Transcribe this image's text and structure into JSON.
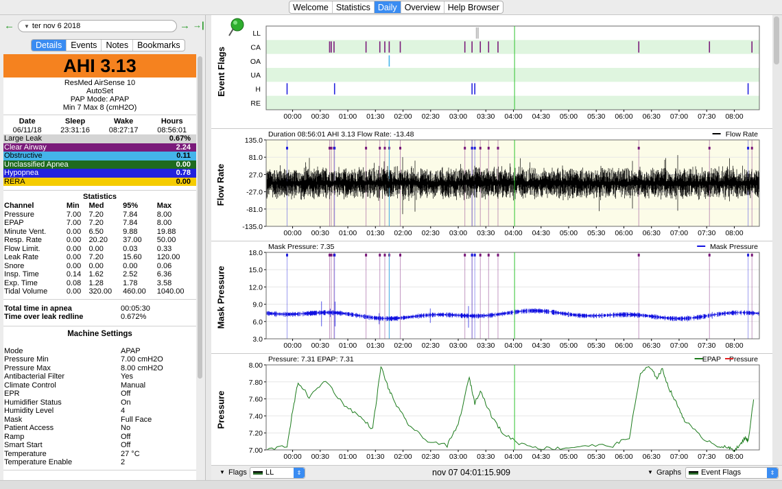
{
  "top_tabs": [
    {
      "label": "Welcome"
    },
    {
      "label": "Statistics"
    },
    {
      "label": "Daily",
      "active": true
    },
    {
      "label": "Overview"
    },
    {
      "label": "Help Browser"
    }
  ],
  "nav": {
    "date": "ter nov 6 2018",
    "back_icon": "arrow-left-icon",
    "forward_icon": "arrow-right-icon",
    "last_icon": "jump-to-last-icon"
  },
  "left_tabs": [
    {
      "label": "Details",
      "active": true
    },
    {
      "label": "Events"
    },
    {
      "label": "Notes"
    },
    {
      "label": "Bookmarks"
    }
  ],
  "summary": {
    "ahi": "AHI 3.13",
    "machine": "ResMed AirSense 10",
    "model": "AutoSet",
    "mode": "PAP Mode: APAP",
    "range": "Min 7 Max 8 (cmH2O)"
  },
  "session": {
    "headers": [
      "Date",
      "Sleep",
      "Wake",
      "Hours"
    ],
    "values": [
      "06/11/18",
      "23:31:16",
      "08:27:17",
      "08:56:01"
    ]
  },
  "events": [
    {
      "name": "Large Leak",
      "value": "0.67%",
      "color": "#d4d4d4",
      "text": "#000"
    },
    {
      "name": "Clear Airway",
      "value": "2.24",
      "color": "#7a1a7a",
      "text": "#fff"
    },
    {
      "name": "Obstructive",
      "value": "0.11",
      "color": "#44b4ea",
      "text": "#000"
    },
    {
      "name": "Unclassified Apnea",
      "value": "0.00",
      "color": "#1e6a1e",
      "text": "#fff"
    },
    {
      "name": "Hypopnea",
      "value": "0.78",
      "color": "#2222dd",
      "text": "#fff"
    },
    {
      "name": "RERA",
      "value": "0.00",
      "color": "#f5cc00",
      "text": "#000"
    }
  ],
  "statistics": {
    "title": "Statistics",
    "headers": [
      "Channel",
      "Min",
      "Med",
      "95%",
      "Max"
    ],
    "rows": [
      [
        "Pressure",
        "7.00",
        "7.20",
        "7.84",
        "8.00"
      ],
      [
        "EPAP",
        "7.00",
        "7.20",
        "7.84",
        "8.00"
      ],
      [
        "Minute Vent.",
        "0.00",
        "6.50",
        "9.88",
        "19.88"
      ],
      [
        "Resp. Rate",
        "0.00",
        "20.20",
        "37.00",
        "50.00"
      ],
      [
        "Flow Limit.",
        "0.00",
        "0.00",
        "0.03",
        "0.33"
      ],
      [
        "Leak Rate",
        "0.00",
        "7.20",
        "15.60",
        "120.00"
      ],
      [
        "Snore",
        "0.00",
        "0.00",
        "0.00",
        "0.06"
      ],
      [
        "Insp. Time",
        "0.14",
        "1.62",
        "2.52",
        "6.36"
      ],
      [
        "Exp. Time",
        "0.08",
        "1.28",
        "1.78",
        "3.58"
      ],
      [
        "Tidal Volume",
        "0.00",
        "320.00",
        "460.00",
        "1040.00"
      ]
    ]
  },
  "apnea": [
    {
      "label": "Total time in apnea",
      "value": "00:05:30"
    },
    {
      "label": "Time over leak redline",
      "value": "0.672%"
    }
  ],
  "settings": {
    "title": "Machine Settings",
    "rows": [
      [
        "Mode",
        "APAP"
      ],
      [
        "Pressure Min",
        "7.00 cmH2O"
      ],
      [
        "Pressure Max",
        "8.00 cmH2O"
      ],
      [
        "Antibacterial Filter",
        "Yes"
      ],
      [
        "Climate Control",
        "Manual"
      ],
      [
        "EPR",
        "Off"
      ],
      [
        "Humidifier Status",
        "On"
      ],
      [
        "Humidity Level",
        "4"
      ],
      [
        "Mask",
        "Full Face"
      ],
      [
        "Patient Access",
        "No"
      ],
      [
        "Ramp",
        "Off"
      ],
      [
        "Smart Start",
        "Off"
      ],
      [
        "Temperature",
        "27 °C"
      ],
      [
        "Temperature Enable",
        "2"
      ]
    ]
  },
  "time_ticks": [
    "00:00",
    "00:30",
    "01:00",
    "01:30",
    "02:00",
    "02:30",
    "03:00",
    "03:30",
    "04:00",
    "04:30",
    "05:00",
    "05:30",
    "06:00",
    "06:30",
    "07:00",
    "07:30",
    "08:00"
  ],
  "graphs": {
    "event_flags": {
      "title": "Event Flags",
      "rows": [
        "LL",
        "CA",
        "OA",
        "UA",
        "H",
        "RE"
      ],
      "pin_icon": "pushpin-icon"
    },
    "flow": {
      "title": "Flow Rate",
      "header": "Duration 08:56:01 AHI 3.13 Flow Rate: -13.48",
      "legend": "Flow Rate",
      "yticks": [
        "135.0",
        "81.0",
        "27.0",
        "-27.0",
        "-81.0",
        "-135.0"
      ]
    },
    "mask": {
      "title": "Mask Pressure",
      "header": "Mask Pressure: 7.35",
      "legend": "Mask Pressure",
      "yticks": [
        "18.0",
        "15.0",
        "12.0",
        "9.0",
        "6.0",
        "3.0"
      ]
    },
    "pressure": {
      "title": "Pressure",
      "header": "Pressure: 7.31 EPAP: 7.31",
      "legend_epap": "EPAP",
      "legend_pressure": "Pressure",
      "yticks": [
        "8.00",
        "7.80",
        "7.60",
        "7.40",
        "7.20",
        "7.00"
      ]
    }
  },
  "bottom": {
    "flags_label": "Flags",
    "flags_value": "LL",
    "time": "nov 07 04:01:15.909",
    "graphs_label": "Graphs",
    "graphs_value": "Event Flags"
  },
  "colors": {
    "accent": "#3a8cf2",
    "ca": "#7a1a7a",
    "oa": "#44b4ea",
    "hyp": "#2222dd",
    "ll": "#b4b4b4",
    "flow": "#000000",
    "mask": "#1010e0",
    "epap": "#1a7a1a",
    "cursor": "#2ec42e",
    "band": "#dff5df"
  },
  "chart_data": [
    {
      "type": "scatter",
      "title": "Event Flags",
      "rows": [
        "LL",
        "CA",
        "OA",
        "UA",
        "H",
        "RE"
      ],
      "x_unit": "hours since 00:00",
      "events": {
        "LL": [
          3.33,
          3.36
        ],
        "CA": [
          0.67,
          0.7,
          0.75,
          1.33,
          1.58,
          1.67,
          1.75,
          1.95,
          3.12,
          3.25,
          3.4,
          3.55,
          3.72,
          6.27,
          7.55,
          8.32
        ],
        "OA": [
          1.75
        ],
        "UA": [],
        "H": [
          -0.1,
          0.76,
          3.25,
          3.3,
          8.25
        ],
        "RE": []
      }
    },
    {
      "type": "line",
      "title": "Flow Rate",
      "ylim": [
        -135,
        135
      ],
      "yticks": [
        -135,
        -81,
        -27,
        27,
        81,
        135
      ],
      "cursor_time": "04:01"
    },
    {
      "type": "line",
      "title": "Mask Pressure",
      "ylim": [
        3,
        18
      ],
      "yticks": [
        3,
        6,
        9,
        12,
        15,
        18
      ]
    },
    {
      "type": "line",
      "title": "Pressure",
      "ylim": [
        7.0,
        8.0
      ],
      "yticks": [
        7.0,
        7.2,
        7.4,
        7.6,
        7.8,
        8.0
      ],
      "series": [
        {
          "name": "EPAP",
          "x": [
            -0.5,
            -0.1,
            0.0,
            0.1,
            0.3,
            0.6,
            0.9,
            1.2,
            1.45,
            1.6,
            1.75,
            1.9,
            2.1,
            2.4,
            2.8,
            3.0,
            3.2,
            3.3,
            3.4,
            3.6,
            3.8,
            4.1,
            4.5,
            4.9,
            5.3,
            5.8,
            6.1,
            6.3,
            6.45,
            6.6,
            6.7,
            6.8,
            6.95,
            7.1,
            7.4,
            7.7,
            7.9,
            8.0,
            8.1,
            8.2,
            8.25,
            8.35
          ],
          "y": [
            7.0,
            7.05,
            7.45,
            7.8,
            7.62,
            7.82,
            7.55,
            7.4,
            7.25,
            7.98,
            7.7,
            7.5,
            7.3,
            7.12,
            7.05,
            7.3,
            7.85,
            7.55,
            7.7,
            7.4,
            7.2,
            7.08,
            7.02,
            7.02,
            7.05,
            7.05,
            7.15,
            7.9,
            7.98,
            7.85,
            7.95,
            7.75,
            7.55,
            7.35,
            7.15,
            7.05,
            7.02,
            7.0,
            7.05,
            7.15,
            7.1,
            7.6
          ]
        },
        {
          "name": "Pressure",
          "x": [],
          "y": []
        }
      ]
    }
  ]
}
